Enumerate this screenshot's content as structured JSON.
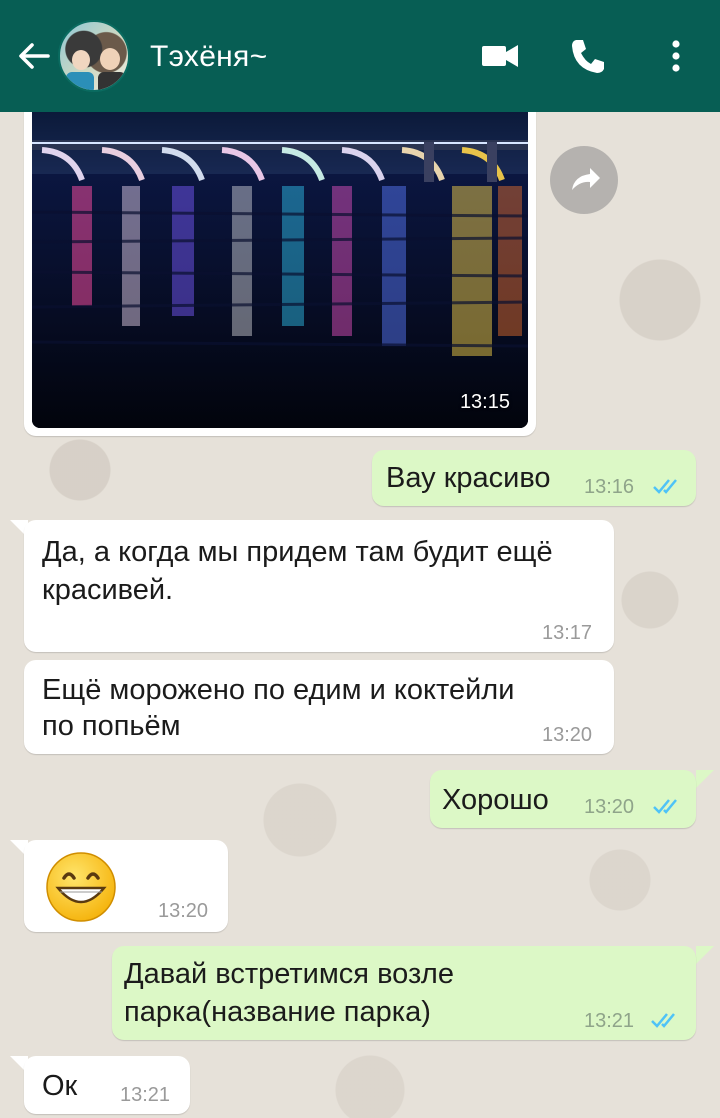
{
  "header": {
    "contact_name": "Тэхёня~",
    "back_icon": "arrow-left-icon",
    "video_icon": "video-call-icon",
    "call_icon": "phone-icon",
    "menu_icon": "more-vert-icon",
    "bg_color": "#075e54"
  },
  "messages": [
    {
      "type": "image",
      "direction": "in",
      "time": "13:15"
    },
    {
      "type": "text",
      "direction": "out",
      "text": "Вау красиво",
      "time": "13:16",
      "status": "read"
    },
    {
      "type": "text",
      "direction": "in",
      "line1": "Да, а когда мы придем там будит ещё",
      "line2": "красивей.",
      "time": "13:17"
    },
    {
      "type": "text",
      "direction": "in",
      "line1": "Ещё мороженo по едим и коктейли",
      "line2": "по попьём",
      "time": "13:20"
    },
    {
      "type": "text",
      "direction": "out",
      "text": "Хорошо",
      "time": "13:20",
      "status": "read"
    },
    {
      "type": "emoji",
      "direction": "in",
      "emoji": "grinning-face-emoji",
      "time": "13:20"
    },
    {
      "type": "text",
      "direction": "out",
      "line1": "Давай встретимся возле",
      "line2": "парка(название парка)",
      "time": "13:21",
      "status": "read"
    },
    {
      "type": "text",
      "direction": "in",
      "text": "Ок",
      "time": "13:21"
    }
  ],
  "colors": {
    "incoming": "#ffffff",
    "outgoing": "#dcf8c6",
    "read_ticks": "#4fc3f7"
  }
}
